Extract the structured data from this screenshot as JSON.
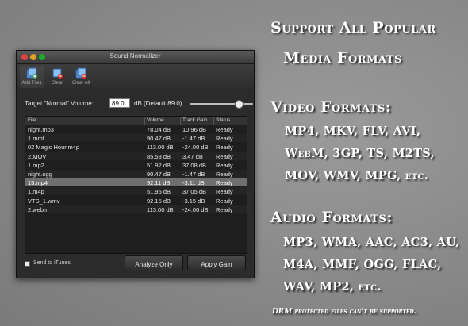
{
  "window": {
    "title": "Sound Normalizer",
    "toolbar": [
      {
        "label": "Add Files",
        "icon": "add-files-icon"
      },
      {
        "label": "Clear",
        "icon": "clear-icon"
      },
      {
        "label": "Clear All",
        "icon": "clear-all-icon"
      }
    ],
    "target": {
      "label": "Target \"Normal\" Volume:",
      "value": "89.0",
      "default_text": "dB (Default 89.0)",
      "slider_level": 0.78
    },
    "table": {
      "headers": [
        "File",
        "Volume",
        "Track Gain",
        "Status"
      ],
      "rows": [
        {
          "file": "night.mp3",
          "volume": "78.04 dB",
          "gain": "10.96 dB",
          "status": "Ready"
        },
        {
          "file": "1.mmf",
          "volume": "90.47 dB",
          "gain": "-1.47 dB",
          "status": "Ready"
        },
        {
          "file": "02 Magic Hour.m4p",
          "volume": "113.00 dB",
          "gain": "-24.00 dB",
          "status": "Ready"
        },
        {
          "file": "2.MOV",
          "volume": "85.53 dB",
          "gain": "3.47 dB",
          "status": "Ready"
        },
        {
          "file": "1.mp2",
          "volume": "51.92 dB",
          "gain": "37.08 dB",
          "status": "Ready"
        },
        {
          "file": "night.ogg",
          "volume": "90.47 dB",
          "gain": "-1.47 dB",
          "status": "Ready"
        },
        {
          "file": "15.mp4",
          "volume": "92.11 dB",
          "gain": "-3.11 dB",
          "status": "Ready"
        },
        {
          "file": "1.m4p",
          "volume": "51.95 dB",
          "gain": "37.05 dB",
          "status": "Ready"
        },
        {
          "file": "VTS_1.wmv",
          "volume": "92.15 dB",
          "gain": "-3.15 dB",
          "status": "Ready"
        },
        {
          "file": "2.webm",
          "volume": "113.00 dB",
          "gain": "-24.00 dB",
          "status": "Ready"
        }
      ],
      "selected_index": 6
    },
    "send_itunes": "Send to iTunes",
    "analyze_button": "Analyze Only",
    "apply_button": "Apply Gain"
  },
  "promo": {
    "heading1": "Support All Popular",
    "heading2": "Media Formats",
    "video_heading": "Video Formats:",
    "video_lines": [
      "MP4, MKV, FLV, AVI,",
      "WebM, 3GP, TS, M2TS,",
      "MOV, WMV, MPG, etc."
    ],
    "audio_heading": "Audio Formats:",
    "audio_lines": [
      "MP3, WMA, AAC, AC3, AU,",
      "M4A, MMF, OGG, FLAC,",
      "WAV, MP2, etc."
    ],
    "note": "DRM protected files can't be supported."
  },
  "colors": {
    "background": "#8e8e8e",
    "window_bg": "#2b2b2b",
    "selected_row": "#6f6f6f"
  }
}
